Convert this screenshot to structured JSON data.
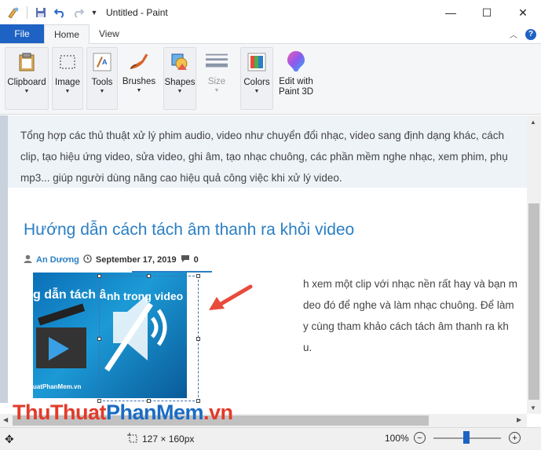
{
  "window": {
    "title": "Untitled - Paint",
    "minimize": "—",
    "maximize": "☐",
    "close": "✕"
  },
  "tabs": {
    "file": "File",
    "home": "Home",
    "view": "View"
  },
  "ribbon": {
    "clipboard": "Clipboard",
    "image": "Image",
    "tools": "Tools",
    "brushes": "Brushes",
    "shapes": "Shapes",
    "size": "Size",
    "colors": "Colors",
    "paint3d_line1": "Edit with",
    "paint3d_line2": "Paint 3D"
  },
  "canvas": {
    "desc_lines": [
      "Tổng hợp các thủ thuật xử lý phim audio, video như chuyển đổi nhạc, video sang định dạng khác, cách ",
      "clip, tạo hiệu ứng video, sửa video, ghi âm, tạo nhạc chuông, các phần mềm nghe nhạc, xem phim, phụ",
      "mp3... giúp người dùng nâng cao hiệu quả công việc khi xử lý video."
    ],
    "article_title": "Hướng dẫn cách tách âm thanh ra khỏi video",
    "author": "An Dương",
    "date": "September 17, 2019",
    "comments": "0",
    "thumb_text_left": "g dẫn tách â",
    "thumb_text_right": "nh trong video",
    "thumb_watermark": "uatPhanMem.vn",
    "body_lines": [
      "h xem một clip với nhạc nền rất hay và bạn m",
      "deo đó để nghe và làm nhạc chuông. Để làm",
      "y cùng tham khảo cách tách âm thanh ra kh",
      "u."
    ]
  },
  "brand": {
    "part1": "ThuThuat",
    "part2": "PhanMem",
    "part3": ".vn"
  },
  "status": {
    "selection_size": "127 × 160px",
    "zoom": "100%",
    "zoom_level": 1.0
  },
  "colors": {
    "accent": "#1e62c4",
    "link": "#2b7fc4",
    "arrow": "#e84b3c"
  }
}
